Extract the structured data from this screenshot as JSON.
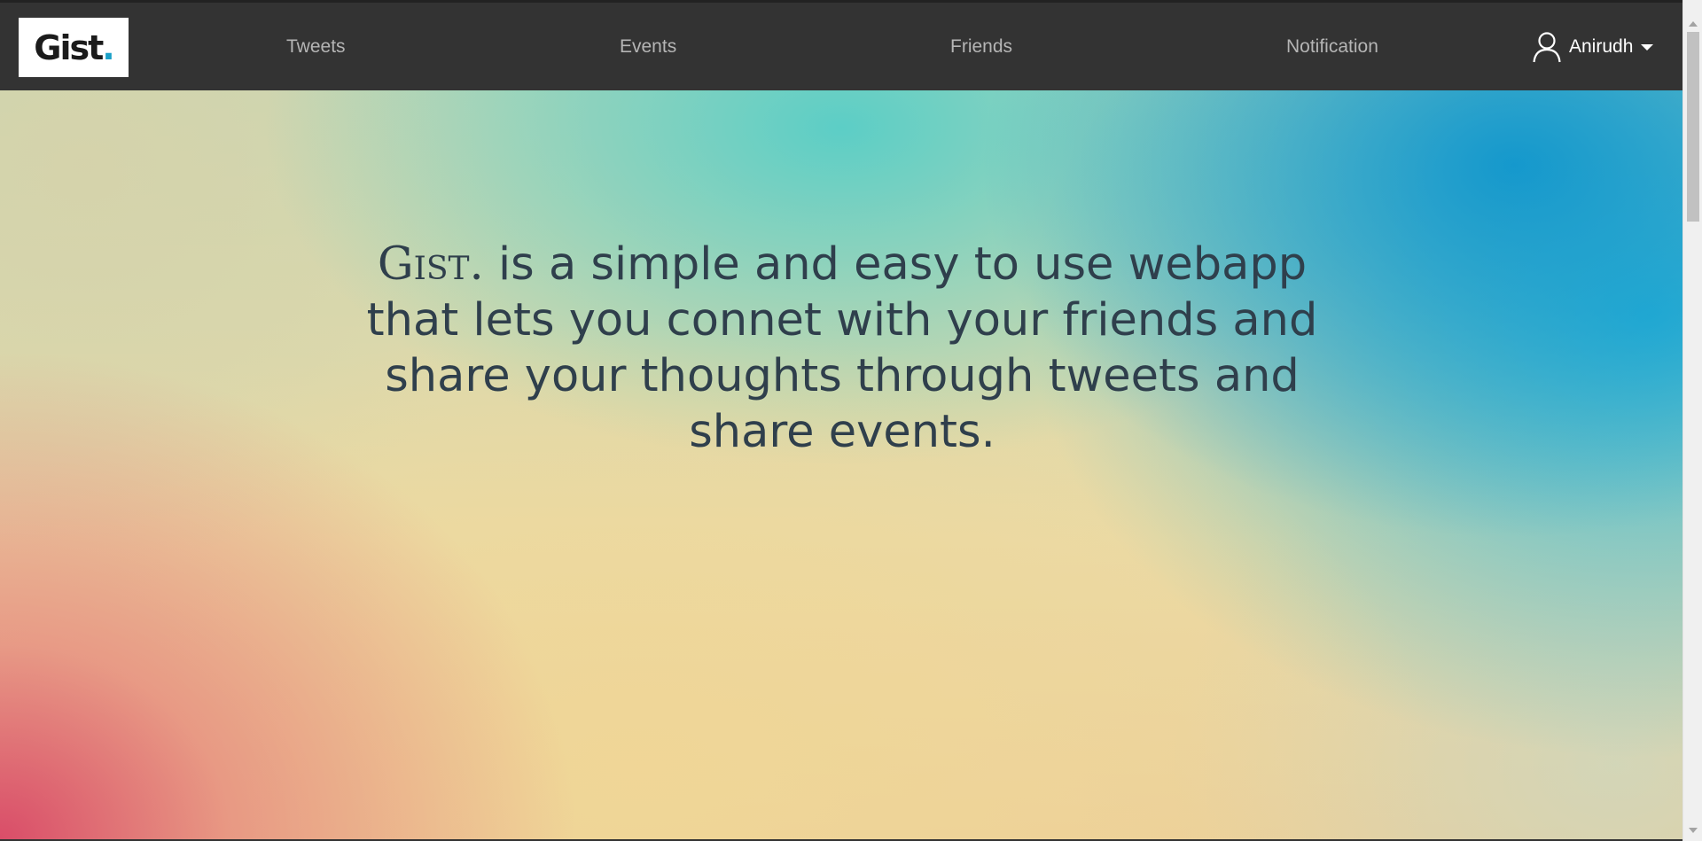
{
  "navbar": {
    "logo": {
      "text": "Gist",
      "dot": "."
    },
    "links": [
      {
        "label": "Tweets"
      },
      {
        "label": "Events"
      },
      {
        "label": "Friends"
      },
      {
        "label": "Notification"
      }
    ],
    "user": {
      "name": "Anirudh",
      "icon": "user-icon"
    }
  },
  "hero": {
    "brand": "Gist.",
    "tagline": " is a simple and easy to use webapp that lets you connet with your friends and share your thoughts through tweets and share events."
  },
  "colors": {
    "navbar_bg": "#333333",
    "nav_link": "#b5b5b5",
    "logo_accent": "#1aa0c8",
    "tagline_text": "#2f3f4c"
  }
}
